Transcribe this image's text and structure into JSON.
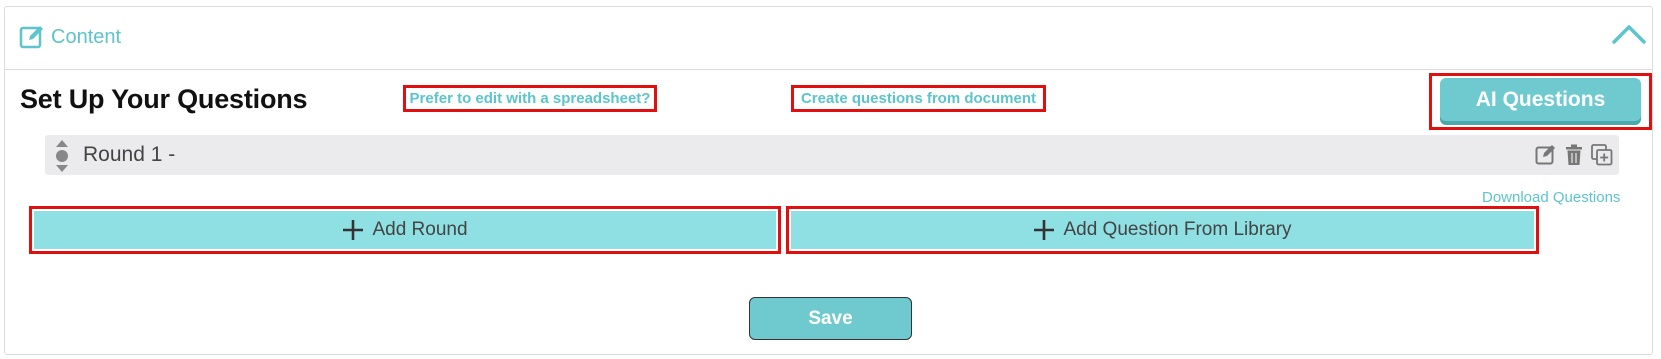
{
  "panel": {
    "title": "Content"
  },
  "main": {
    "heading": "Set Up Your Questions",
    "spreadsheet_link": "Prefer to edit with a spreadsheet?",
    "document_link": "Create questions from document",
    "ai_button": "AI Questions",
    "download_link": "Download Questions",
    "add_round_label": "Add Round",
    "add_library_label": "Add Question From Library",
    "save_label": "Save"
  },
  "rounds": [
    {
      "label": "Round 1 -"
    }
  ],
  "colors": {
    "accent": "#5cc4cc",
    "button": "#6fcacf",
    "add_button": "#8ee0e3",
    "highlight_border": "#e01010",
    "round_row_bg": "#ebebed"
  },
  "icons": {
    "header": "edit-square-icon",
    "collapse": "chevron-up-icon",
    "drag": "drag-handle-icon",
    "edit": "edit-icon",
    "delete": "trash-icon",
    "duplicate": "copy-plus-icon",
    "add": "plus-icon"
  }
}
